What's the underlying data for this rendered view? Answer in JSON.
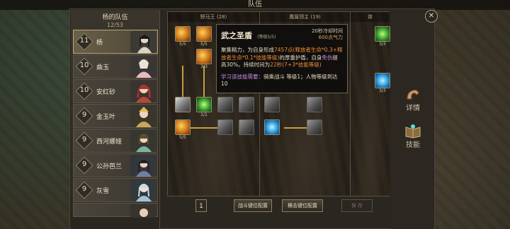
{
  "window": {
    "title": "队伍"
  },
  "team": {
    "title": "杨的队伍",
    "count": "12/53",
    "members": [
      {
        "level": "11",
        "name": "杨",
        "selected": true,
        "color": "#d7d3c7"
      },
      {
        "level": "10",
        "name": "曲玉",
        "selected": false,
        "color": "#e7b8c2"
      },
      {
        "level": "10",
        "name": "安红砂",
        "selected": false,
        "color": "#b8463c"
      },
      {
        "level": "9",
        "name": "金玉叶",
        "selected": false,
        "color": "#c9a45a"
      },
      {
        "level": "9",
        "name": "西河娜娅",
        "selected": false,
        "color": "#7fb0a3"
      },
      {
        "level": "9",
        "name": "公孙芭兰",
        "selected": false,
        "color": "#6f7fa6"
      },
      {
        "level": "9",
        "name": "灰雪",
        "selected": false,
        "color": "#9fc3d6"
      }
    ]
  },
  "tree": {
    "columns": [
      {
        "name": "野马王 (28)"
      },
      {
        "name": "鹰属领主 (19)"
      },
      {
        "name": "体"
      }
    ],
    "skill_labels": [
      "5/5",
      "5/5",
      "3/3",
      "1/1",
      "5/5",
      "3/3",
      "3/3"
    ]
  },
  "tooltip": {
    "name": "武之圣盾",
    "level": "(等级5/5)",
    "cooldown": "20秒冷却时间",
    "cost": "600点气力",
    "desc_1": "聚集精力，为自身形成",
    "desc_value": "7457点(释放者生命*0.3+释放者生命*0.1*技能等级)",
    "desc_2": "的厚重护盾，自身",
    "desc_3": "免伤",
    "desc_4": "提高30%。持续时间为",
    "desc_dur": "22秒",
    "desc_dur_formula": "(7+3*技能等级)",
    "req_head": "学习该技能需要：",
    "req_body": "骑乘战斗 等级1；人物等级到达10"
  },
  "bottom": {
    "points": "1",
    "combat_keys": "战斗键位配置",
    "ride_keys": "横击键位配置",
    "save": "保 存"
  },
  "right_tabs": [
    {
      "label": "详情",
      "icon": "arm-icon"
    },
    {
      "label": "技能",
      "icon": "book-icon"
    }
  ],
  "close_glyph": "✕"
}
